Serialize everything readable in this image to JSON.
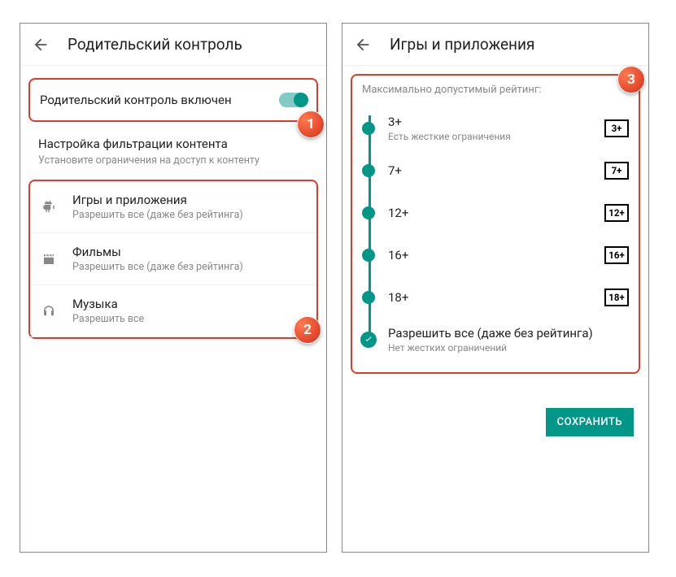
{
  "left": {
    "title": "Родительский контроль",
    "toggleLabel": "Родительский контроль включен",
    "sectionTitle": "Настройка фильтрации контента",
    "sectionSub": "Установите ограничения на доступ к контенту",
    "cats": [
      {
        "label": "Игры и приложения",
        "sub": "Разрешить все (даже без рейтинга)"
      },
      {
        "label": "Фильмы",
        "sub": "Разрешить все (даже без рейтинга)"
      },
      {
        "label": "Музыка",
        "sub": "Разрешить все"
      }
    ]
  },
  "right": {
    "title": "Игры и приложения",
    "caption": "Максимально допустимый рейтинг:",
    "ratings": [
      {
        "label": "3+",
        "sub": "Есть жесткие ограничения",
        "badge": "3+"
      },
      {
        "label": "7+",
        "sub": "",
        "badge": "7+"
      },
      {
        "label": "12+",
        "sub": "",
        "badge": "12+"
      },
      {
        "label": "16+",
        "sub": "",
        "badge": "16+"
      },
      {
        "label": "18+",
        "sub": "",
        "badge": "18+"
      },
      {
        "label": "Разрешить все (даже без рейтинга)",
        "sub": "Нет жестких ограничений",
        "badge": ""
      }
    ],
    "saveLabel": "СОХРАНИТЬ"
  },
  "badges": {
    "b1": "1",
    "b2": "2",
    "b3": "3"
  }
}
